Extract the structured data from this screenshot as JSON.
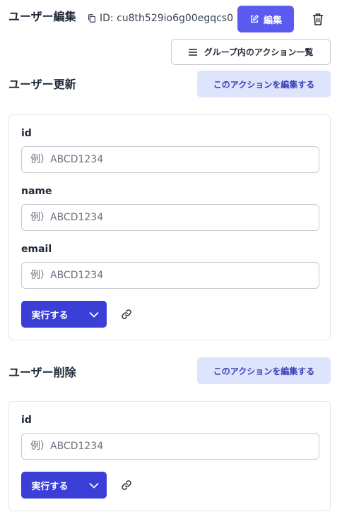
{
  "header": {
    "title": "ユーザー編集",
    "id_text": "ID: cu8th529io6g00egqcs0",
    "edit_label": "編集",
    "group_actions_label": "グループ内のアクション一覧"
  },
  "sections": [
    {
      "title": "ユーザー更新",
      "edit_action_label": "このアクションを編集する",
      "fields": [
        {
          "label": "id",
          "placeholder": "例）ABCD1234"
        },
        {
          "label": "name",
          "placeholder": "例）ABCD1234"
        },
        {
          "label": "email",
          "placeholder": "例）ABCD1234"
        }
      ],
      "run_label": "実行する"
    },
    {
      "title": "ユーザー削除",
      "edit_action_label": "このアクションを編集する",
      "fields": [
        {
          "label": "id",
          "placeholder": "例）ABCD1234"
        }
      ],
      "run_label": "実行する"
    }
  ],
  "colors": {
    "primary": "#5b5bf0",
    "run_button": "#3b3fd8",
    "secondary_bg": "#dde4fb",
    "secondary_text": "#3b3fb8"
  }
}
